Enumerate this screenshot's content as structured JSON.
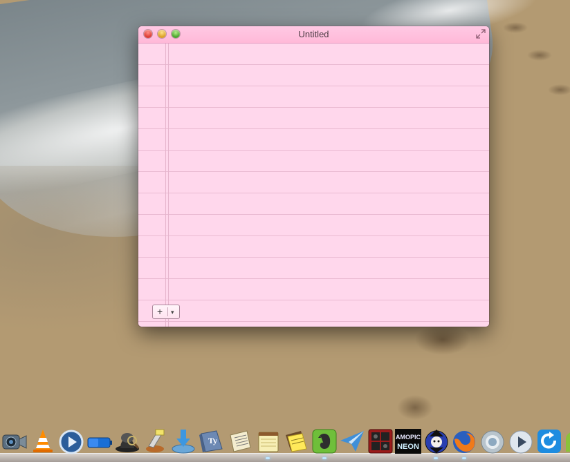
{
  "window": {
    "title": "Untitled",
    "note_text": "",
    "add_button_symbol": "+",
    "add_menu_arrow": "▾"
  },
  "dock": {
    "items": [
      {
        "icon": "facetime-camera-icon"
      },
      {
        "icon": "vlc-cone-icon"
      },
      {
        "icon": "quicktime-play-icon"
      },
      {
        "icon": "battery-app-icon"
      },
      {
        "icon": "alfred-hat-icon"
      },
      {
        "icon": "sharing-app-icon"
      },
      {
        "icon": "download-manager-icon"
      },
      {
        "icon": "typinator-icon",
        "label": "Ty"
      },
      {
        "icon": "notebook-app-icon"
      },
      {
        "icon": "notepad-app-icon"
      },
      {
        "icon": "sticky-notes-icon"
      },
      {
        "icon": "evernote-icon"
      },
      {
        "icon": "sparrow-mail-icon"
      },
      {
        "icon": "photo-booth-icon"
      },
      {
        "icon": "amopic-neon-icon",
        "label_line1": "AMOPIC",
        "label_line2": "NEON"
      },
      {
        "icon": "anime-character-icon"
      },
      {
        "icon": "firefox-icon"
      },
      {
        "icon": "chrome-icon"
      },
      {
        "icon": "media-player-icon"
      },
      {
        "icon": "refresh-app-icon"
      },
      {
        "icon": "android-icon"
      }
    ]
  },
  "colors": {
    "note_background": "#ffd7ec",
    "titlebar": "#ffc9e4",
    "rule_line": "#e9b9d1"
  }
}
